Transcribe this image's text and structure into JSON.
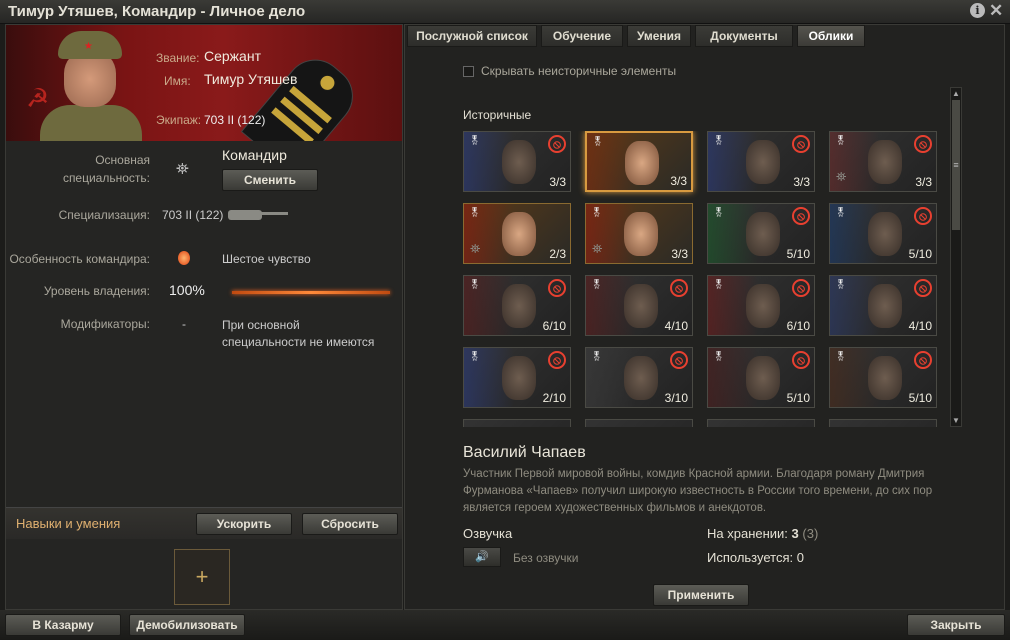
{
  "window": {
    "title": "Тимур Утяшев, Командир - Личное дело",
    "info_icon": "info-icon",
    "close_icon": "close-icon"
  },
  "profile": {
    "rank_label": "Звание:",
    "rank": "Сержант",
    "name_label": "Имя:",
    "name": "Тимур Утяшев",
    "crew_label": "Экипаж:",
    "crew": "703 II (122)"
  },
  "details": {
    "specialty_label": "Основная специальность:",
    "specialty": "Командир",
    "change_btn": "Сменить",
    "specialization_label": "Специализация:",
    "specialization": "703 II (122)",
    "feature_label": "Особенность командира:",
    "feature": "Шестое чувство",
    "proficiency_label": "Уровень владения:",
    "proficiency": "100%",
    "proficiency_fraction": 1.0,
    "modifiers_label": "Модификаторы:",
    "modifiers_dash": "-",
    "modifiers_text": "При основной специальности не имеются"
  },
  "skills": {
    "title": "Навыки и умения",
    "accelerate_btn": "Ускорить",
    "reset_btn": "Сбросить",
    "add_slot": "+"
  },
  "tabs": [
    "Послужной список",
    "Обучение",
    "Умения",
    "Документы",
    "Облики"
  ],
  "active_tab": "Облики",
  "filter": {
    "hide_nonhistorical": "Скрывать неисторичные элементы",
    "checked": false
  },
  "section_label": "Историчные",
  "skins": [
    {
      "count": "3/3",
      "locked": true,
      "owned": false,
      "tint": "#2a3a7a"
    },
    {
      "count": "3/3",
      "locked": false,
      "owned": true,
      "selected": true,
      "tint": "#7a2a10"
    },
    {
      "count": "3/3",
      "locked": true,
      "owned": false,
      "tint": "#2a3a7a"
    },
    {
      "count": "3/3",
      "locked": true,
      "owned": false,
      "tint": "#6a2a2a"
    },
    {
      "count": "2/3",
      "locked": false,
      "owned": true,
      "tint": "#8a1a10"
    },
    {
      "count": "3/3",
      "locked": false,
      "owned": true,
      "tint": "#8a1a10"
    },
    {
      "count": "5/10",
      "locked": true,
      "owned": false,
      "tint": "#1a5a2a"
    },
    {
      "count": "5/10",
      "locked": true,
      "owned": false,
      "tint": "#1a3a6a"
    },
    {
      "count": "6/10",
      "locked": true,
      "owned": false,
      "tint": "#5a1a1a"
    },
    {
      "count": "4/10",
      "locked": true,
      "owned": false,
      "tint": "#5a1a1a"
    },
    {
      "count": "6/10",
      "locked": true,
      "owned": false,
      "tint": "#6a1a1a"
    },
    {
      "count": "4/10",
      "locked": true,
      "owned": false,
      "tint": "#2a3a6a"
    },
    {
      "count": "2/10",
      "locked": true,
      "owned": false,
      "tint": "#2a3a7a"
    },
    {
      "count": "3/10",
      "locked": true,
      "owned": false,
      "tint": "#3a3a3a"
    },
    {
      "count": "5/10",
      "locked": true,
      "owned": false,
      "tint": "#4a1a1a"
    },
    {
      "count": "5/10",
      "locked": true,
      "owned": false,
      "tint": "#4a2a1a"
    }
  ],
  "selected": {
    "name": "Василий Чапаев",
    "description": "Участник Первой мировой войны, комдив Красной армии. Благодаря роману Дмитрия Фурманова «Чапаев» получил широкую известность в России того времени, до сих пор является героем художественных фильмов и анекдотов.",
    "voice_label": "Озвучка",
    "voice_value": "Без озвучки",
    "storage_label": "На хранении:",
    "storage_value": "3",
    "storage_total": "(3)",
    "used_label": "Используется:",
    "used_value": "0"
  },
  "apply_btn": "Применить",
  "footer": {
    "barracks_btn": "В Казарму",
    "demobilize_btn": "Демобилизовать",
    "close_btn": "Закрыть"
  }
}
